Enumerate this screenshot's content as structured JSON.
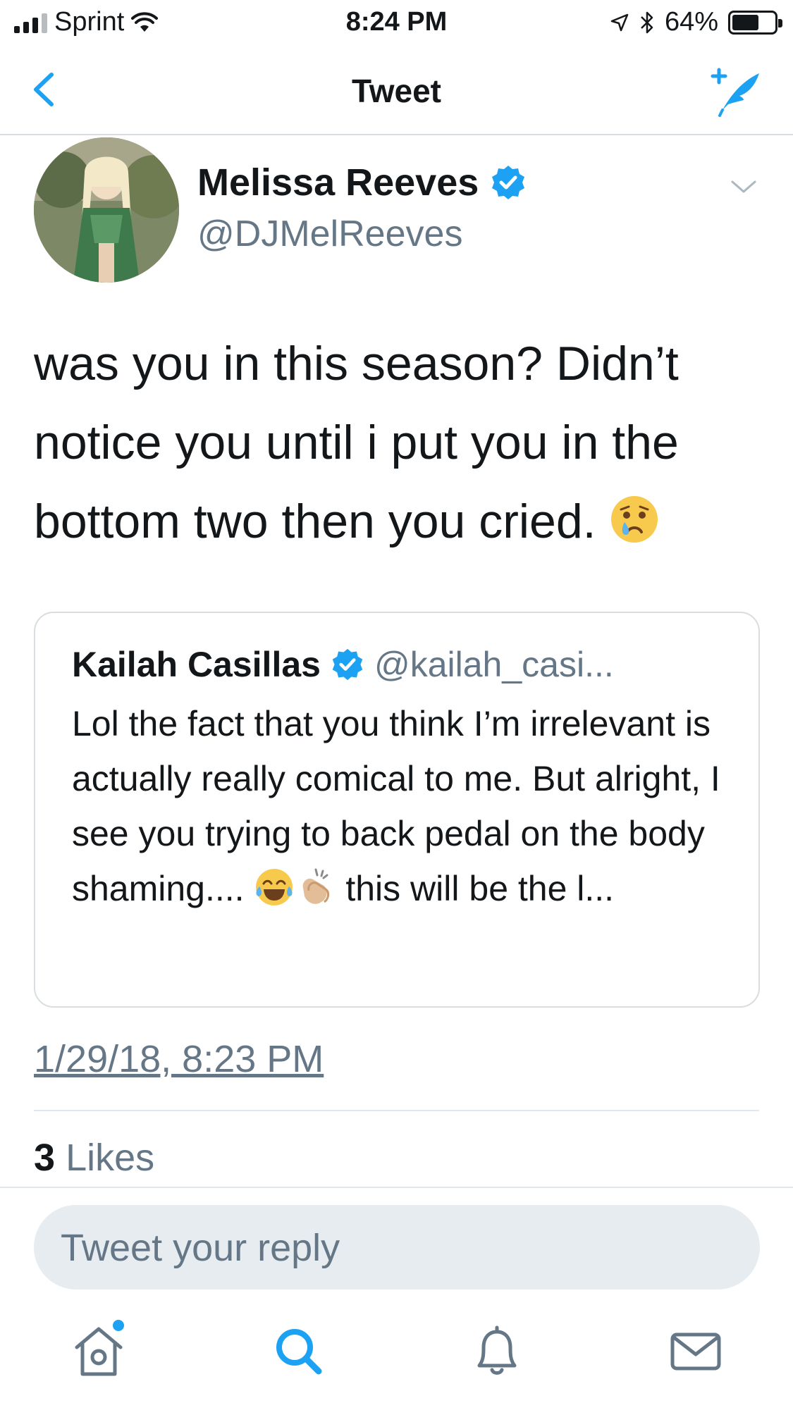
{
  "status_bar": {
    "carrier": "Sprint",
    "time": "8:24 PM",
    "battery": "64%",
    "battery_level": 0.64
  },
  "nav": {
    "title": "Tweet",
    "back_icon": "chevron-left-icon",
    "compose_icon": "compose-tweet-icon"
  },
  "tweet": {
    "author_name": "Melissa Reeves",
    "author_handle": "@DJMelReeves",
    "text": "was you in this season? Didn’t notice you until i put you in the bottom two then you cried.",
    "emoji": "crying-face-emoji",
    "timestamp": "1/29/18, 8:23 PM",
    "likes_count": "3",
    "likes_label": "Likes"
  },
  "quoted_tweet": {
    "author_name": "Kailah Casillas",
    "author_handle": "@kailah_casi...",
    "text_before": "Lol the fact that you think I’m irrelevant is actually really comical to me. But alright, I see you trying to back pedal on the body shaming....",
    "text_after": " this will be the l...",
    "emojis": [
      "tears-of-joy-emoji",
      "clapping-hands-emoji"
    ]
  },
  "reply": {
    "placeholder": "Tweet your reply"
  },
  "tab_bar": {
    "items": [
      "home-icon",
      "search-icon",
      "notifications-icon",
      "messages-icon"
    ]
  },
  "colors": {
    "accent": "#1da1f2",
    "secondary_text": "#657786",
    "primary_text": "#14171a",
    "divider": "#e1e8ed"
  }
}
